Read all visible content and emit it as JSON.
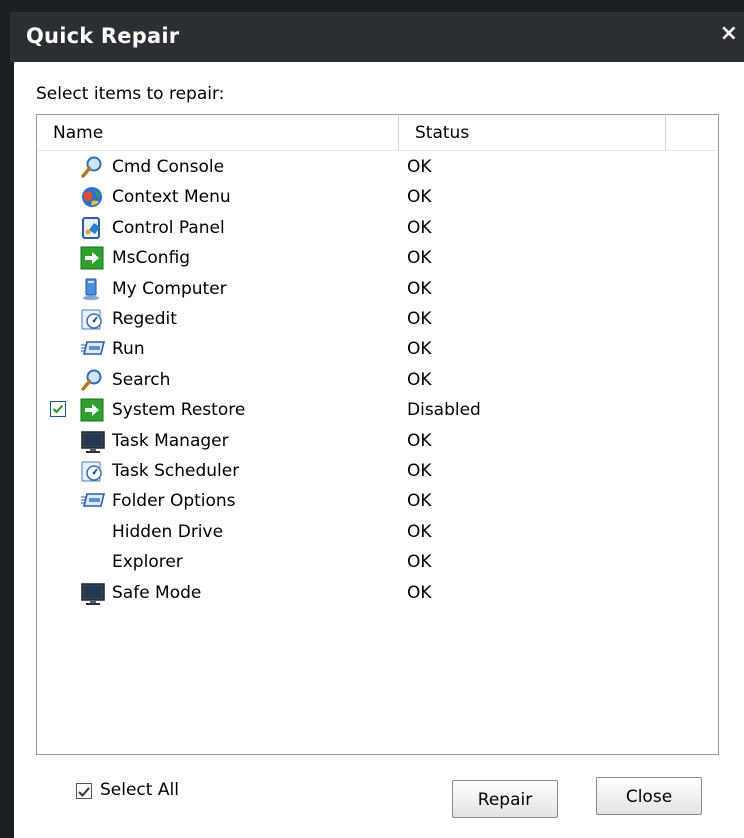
{
  "window": {
    "title": "Quick Repair",
    "close_glyph": "×"
  },
  "prompt": "Select items to repair:",
  "columns": {
    "name": "Name",
    "status": "Status"
  },
  "items": [
    {
      "name": "Cmd Console",
      "status": "OK",
      "icon": "magnifier-icon",
      "checked": false
    },
    {
      "name": "Context Menu",
      "status": "OK",
      "icon": "globe-icon",
      "checked": false
    },
    {
      "name": "Control Panel",
      "status": "OK",
      "icon": "control-panel-icon",
      "checked": false
    },
    {
      "name": "MsConfig",
      "status": "OK",
      "icon": "green-arrow-icon",
      "checked": false
    },
    {
      "name": "My Computer",
      "status": "OK",
      "icon": "computer-icon",
      "checked": false
    },
    {
      "name": "Regedit",
      "status": "OK",
      "icon": "gauge-icon",
      "checked": false
    },
    {
      "name": "Run",
      "status": "OK",
      "icon": "run-icon",
      "checked": false
    },
    {
      "name": "Search",
      "status": "OK",
      "icon": "magnifier-icon",
      "checked": false
    },
    {
      "name": "System Restore",
      "status": "Disabled",
      "icon": "green-arrow-icon",
      "checked": true
    },
    {
      "name": "Task Manager",
      "status": "OK",
      "icon": "monitor-icon",
      "checked": false
    },
    {
      "name": "Task Scheduler",
      "status": "OK",
      "icon": "gauge-icon",
      "checked": false
    },
    {
      "name": "Folder Options",
      "status": "OK",
      "icon": "run-icon",
      "checked": false
    },
    {
      "name": "Hidden Drive",
      "status": "OK",
      "icon": "",
      "checked": false
    },
    {
      "name": "Explorer",
      "status": "OK",
      "icon": "",
      "checked": false
    },
    {
      "name": "Safe Mode",
      "status": "OK",
      "icon": "monitor-icon",
      "checked": false
    }
  ],
  "select_all": {
    "label": "Select All",
    "checked": true
  },
  "buttons": {
    "repair": "Repair",
    "close": "Close"
  },
  "colors": {
    "titlebar": "#2b2f33",
    "frame": "#1b1f23",
    "checkbox_check": "#1a9a1a",
    "arrow_green": "#2ea02e"
  }
}
